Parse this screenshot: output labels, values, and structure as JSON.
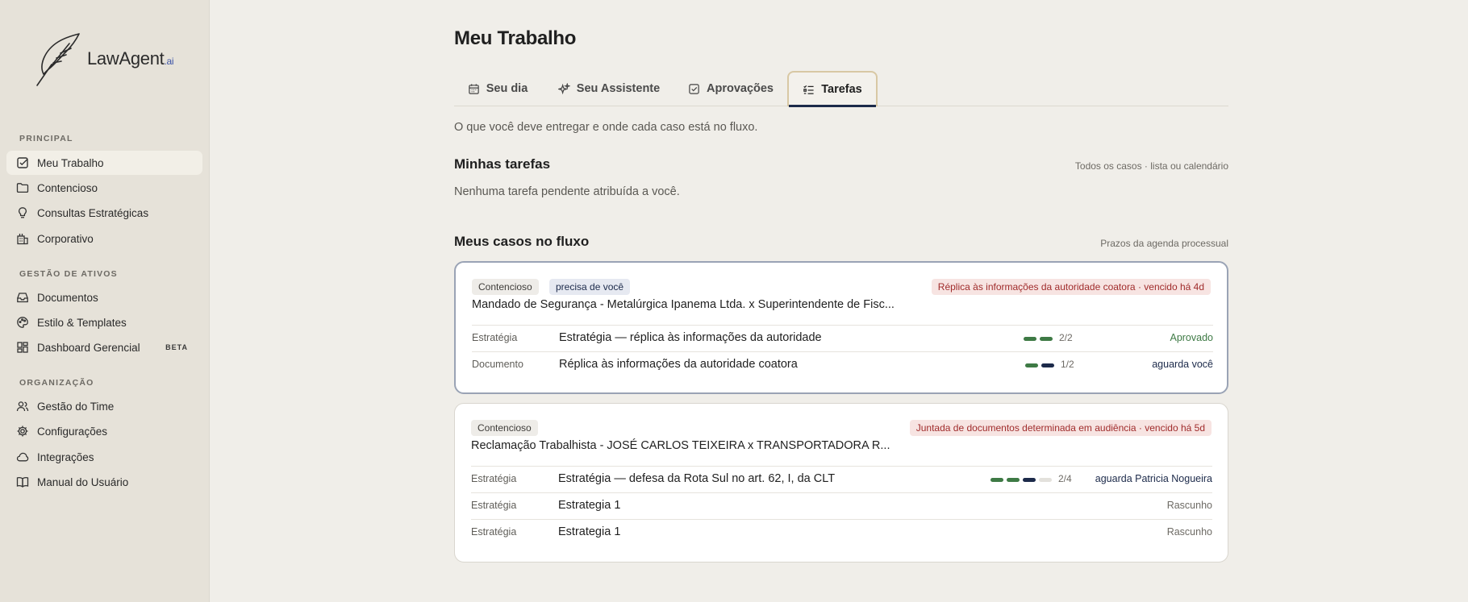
{
  "brand": {
    "name": "LawAgent",
    "suffix": ".ai"
  },
  "sidebar": {
    "sections": [
      {
        "label": "PRINCIPAL"
      },
      {
        "label": "GESTÃO DE ATIVOS"
      },
      {
        "label": "ORGANIZAÇÃO"
      }
    ],
    "items": [
      {
        "label": "Meu Trabalho",
        "icon": "checkbox-icon",
        "active": true
      },
      {
        "label": "Contencioso",
        "icon": "folder-icon"
      },
      {
        "label": "Consultas Estratégicas",
        "icon": "lightbulb-icon"
      },
      {
        "label": "Corporativo",
        "icon": "building-icon"
      },
      {
        "label": "Documentos",
        "icon": "inbox-icon"
      },
      {
        "label": "Estilo & Templates",
        "icon": "palette-icon"
      },
      {
        "label": "Dashboard Gerencial",
        "icon": "dashboard-icon",
        "badge": "BETA"
      },
      {
        "label": "Gestão do Time",
        "icon": "users-icon"
      },
      {
        "label": "Configurações",
        "icon": "gear-icon"
      },
      {
        "label": "Integrações",
        "icon": "cloud-icon"
      },
      {
        "label": "Manual do Usuário",
        "icon": "book-icon"
      }
    ]
  },
  "main": {
    "title": "Meu Trabalho",
    "tabs": [
      {
        "label": "Seu dia",
        "icon": "calendar-icon"
      },
      {
        "label": "Seu Assistente",
        "icon": "sparkle-icon"
      },
      {
        "label": "Aprovações",
        "icon": "check-square-icon"
      },
      {
        "label": "Tarefas",
        "icon": "task-list-icon",
        "active": true
      }
    ],
    "subtitle": "O que você deve entregar e onde cada caso está no fluxo.",
    "tasks": {
      "title": "Minhas tarefas",
      "meta": "Todos os casos · lista ou calendário",
      "empty": "Nenhuma tarefa pendente atribuída a você."
    },
    "cases_section": {
      "title": "Meus casos no fluxo",
      "meta": "Prazos da agenda processual"
    },
    "cases": [
      {
        "area": "Contencioso",
        "flag": "precisa de você",
        "deadline": "Réplica às informações da autoridade coatora · vencido há 4d",
        "title": "Mandado de Segurança - Metalúrgica Ipanema Ltda. x Superintendente de Fisc...",
        "rows": [
          {
            "type": "Estratégia",
            "name": "Estratégia — réplica às informações da autoridade",
            "progress_text": "2/2",
            "steps_done": 2,
            "steps_total": 2,
            "status": "Aprovado"
          },
          {
            "type": "Documento",
            "name": "Réplica às informações da autoridade coatora",
            "progress_text": "1/2",
            "steps_done": 1,
            "steps_total": 2,
            "status": "aguarda você"
          }
        ]
      },
      {
        "area": "Contencioso",
        "deadline": "Juntada de documentos determinada em audiência · vencido há 5d",
        "title": "Reclamação Trabalhista - JOSÉ CARLOS TEIXEIRA x TRANSPORTADORA R...",
        "rows": [
          {
            "type": "Estratégia",
            "name": "Estratégia — defesa da Rota Sul no art. 62, I, da CLT",
            "progress_text": "2/4",
            "steps_done": 2,
            "steps_total": 4,
            "status": "aguarda Patricia Nogueira"
          },
          {
            "type": "Estratégia",
            "name": "Estrategia 1",
            "status": "Rascunho"
          },
          {
            "type": "Estratégia",
            "name": "Estrategia 1",
            "status": "Rascunho"
          }
        ]
      }
    ]
  },
  "colors": {
    "done": "#3e7a45",
    "current": "#1c2a4a",
    "pending": "#e3e1dc",
    "alert": "#a02c2c"
  }
}
